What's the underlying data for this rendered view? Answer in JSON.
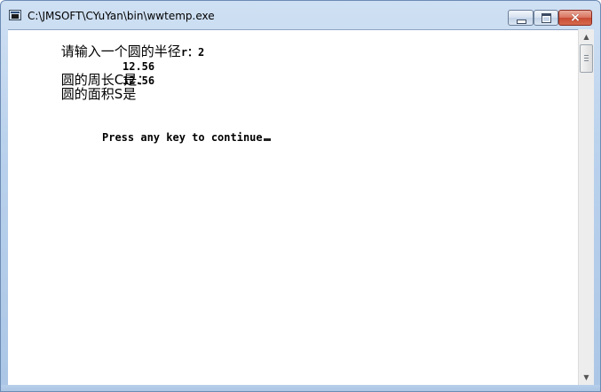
{
  "window": {
    "title": "C:\\JMSOFT\\CYuYan\\bin\\wwtemp.exe",
    "frame_color": "#b9d1ec",
    "close_color": "#c94b32",
    "icons": {
      "app": "console-app-icon",
      "minimize": "minimize-icon",
      "maximize": "maximize-icon",
      "close": "close-icon"
    },
    "close_glyph": "×"
  },
  "console": {
    "line1_text": "请输入一个圆的半径",
    "line1_input": "r：2",
    "line2_text": "圆的周长C是：",
    "line2_value": "12.56",
    "line3_text": "圆的面积S是",
    "line3_value": "12.56",
    "prompt": "Press any key to continue"
  },
  "scrollbar": {
    "up_glyph": "▲",
    "down_glyph": "▼"
  }
}
